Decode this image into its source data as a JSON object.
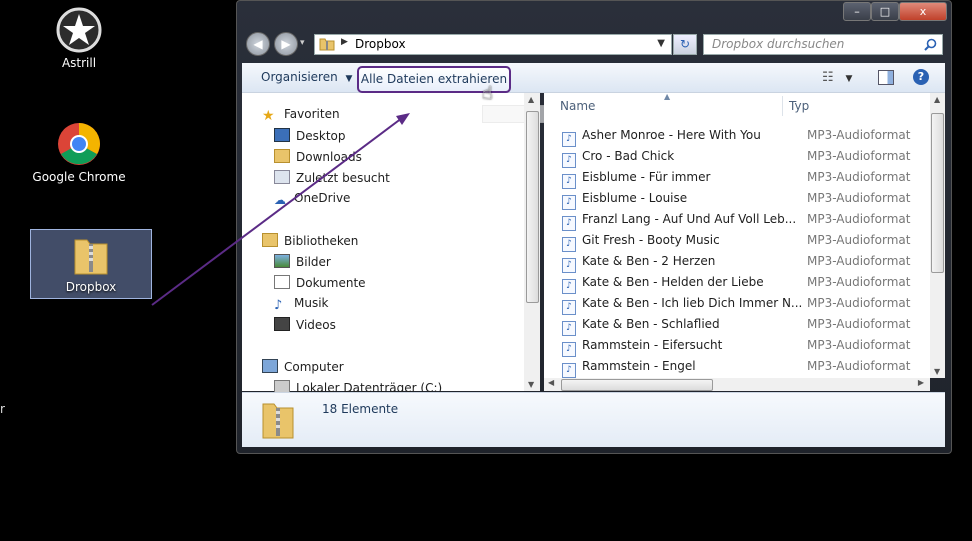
{
  "desktop": {
    "icons": [
      {
        "label": "Astrill"
      },
      {
        "label": "Google Chrome"
      },
      {
        "label": "Dropbox"
      }
    ],
    "edge_text": "r"
  },
  "window": {
    "breadcrumb": "Dropbox",
    "search_placeholder": "Dropbox durchsuchen",
    "controls": {
      "minimize": "–",
      "maximize": "□",
      "close": "x"
    }
  },
  "toolbar": {
    "organize": "Organisieren",
    "extract": "Alle Dateien extrahieren"
  },
  "nav": {
    "favorites": "Favoriten",
    "fav_items": [
      "Desktop",
      "Downloads",
      "Zuletzt besucht",
      "OneDrive"
    ],
    "libraries": "Bibliotheken",
    "lib_items": [
      "Bilder",
      "Dokumente",
      "Musik",
      "Videos"
    ],
    "computer": "Computer",
    "drive": "Lokaler Datenträger (C:)"
  },
  "list": {
    "col_name": "Name",
    "col_type": "Typ",
    "rows": [
      {
        "name": "Asher Monroe - Here With You",
        "type": "MP3-Audioformat"
      },
      {
        "name": "Cro - Bad Chick",
        "type": "MP3-Audioformat"
      },
      {
        "name": "Eisblume - Für immer",
        "type": "MP3-Audioformat"
      },
      {
        "name": "Eisblume - Louise",
        "type": "MP3-Audioformat"
      },
      {
        "name": "Franzl Lang - Auf Und Auf Voll Leb...",
        "type": "MP3-Audioformat"
      },
      {
        "name": "Git Fresh - Booty Music",
        "type": "MP3-Audioformat"
      },
      {
        "name": "Kate & Ben - 2 Herzen",
        "type": "MP3-Audioformat"
      },
      {
        "name": "Kate & Ben - Helden der Liebe",
        "type": "MP3-Audioformat"
      },
      {
        "name": "Kate & Ben - Ich lieb Dich Immer N...",
        "type": "MP3-Audioformat"
      },
      {
        "name": "Kate & Ben - Schlaflied",
        "type": "MP3-Audioformat"
      },
      {
        "name": "Rammstein - Eifersucht",
        "type": "MP3-Audioformat"
      },
      {
        "name": "Rammstein - Engel",
        "type": "MP3-Audioformat"
      }
    ]
  },
  "status": {
    "count": "18 Elemente"
  },
  "colors": {
    "annotation": "#5b2b86",
    "accent": "#1e395b"
  }
}
